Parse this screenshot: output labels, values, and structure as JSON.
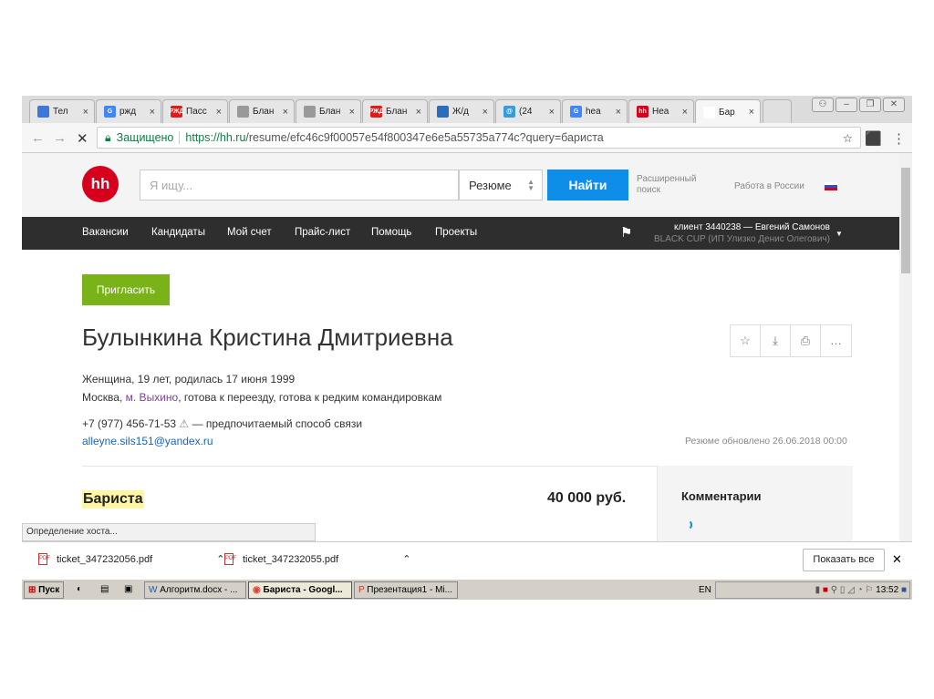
{
  "browser": {
    "tabs": [
      {
        "label": "Тел",
        "fav": "#3b78d8",
        "ic": ""
      },
      {
        "label": "ржд",
        "fav": "#4285f4",
        "ic": "G"
      },
      {
        "label": "Пасс",
        "fav": "#e21a1a",
        "ic": "РЖД"
      },
      {
        "label": "Блан",
        "fav": "#999",
        "ic": ""
      },
      {
        "label": "Блан",
        "fav": "#999",
        "ic": ""
      },
      {
        "label": "Блан",
        "fav": "#e21a1a",
        "ic": "РЖД"
      },
      {
        "label": "Ж/д",
        "fav": "#2a6ebb",
        "ic": ""
      },
      {
        "label": "(24",
        "fav": "#3b9bd8",
        "ic": "@"
      },
      {
        "label": "hea",
        "fav": "#4285f4",
        "ic": "G"
      },
      {
        "label": "Hea",
        "fav": "#d6001c",
        "ic": "hh"
      },
      {
        "label": "Бар",
        "fav": "#fff",
        "ic": ""
      }
    ],
    "secure_label": "Защищено",
    "url_host": "https://hh.ru",
    "url_path": "/resume/efc46c9f00057e54f800347e6e5a55735a774c?query=бариста",
    "status_text": "Определение хоста..."
  },
  "header": {
    "logo": "hh",
    "search_placeholder": "Я ищу...",
    "search_type": "Резюме",
    "find_button": "Найти",
    "advanced": "Расширенный поиск",
    "region": "Работа в России"
  },
  "nav": {
    "items": [
      "Вакансии",
      "Кандидаты",
      "Мой счет",
      "Прайс-лист",
      "Помощь",
      "Проекты"
    ],
    "client": "клиент 3440238 — Евгений Самонов",
    "company": "BLACK CUP (ИП Улизко Денис Олегович)"
  },
  "resume": {
    "invite": "Пригласить",
    "name": "Булынкина Кристина Дмитриевна",
    "bio": "Женщина, 19 лет, родилась 17 июня 1999",
    "city": "Москва, ",
    "metro": "м. Выхино",
    "relocation": ", готова к переезду, готова к редким командировкам",
    "phone": "+7 (977) 456-71-53",
    "phone_note": " — предпочитаемый способ связи",
    "email": "alleyne.sils151@yandex.ru",
    "updated": "Резюме обновлено 26.06.2018 00:00",
    "position": "Бариста",
    "salary": "40 000 руб.",
    "comments_title": "Комментарии"
  },
  "downloads": {
    "files": [
      "ticket_347232056.pdf",
      "ticket_347232055.pdf"
    ],
    "show_all": "Показать все"
  },
  "taskbar": {
    "start": "Пуск",
    "items": [
      "Алгоритм.docx - ...",
      "Бариста - Googl...",
      "Презентация1 - Mi..."
    ],
    "lang": "EN",
    "clock": "13:52"
  }
}
